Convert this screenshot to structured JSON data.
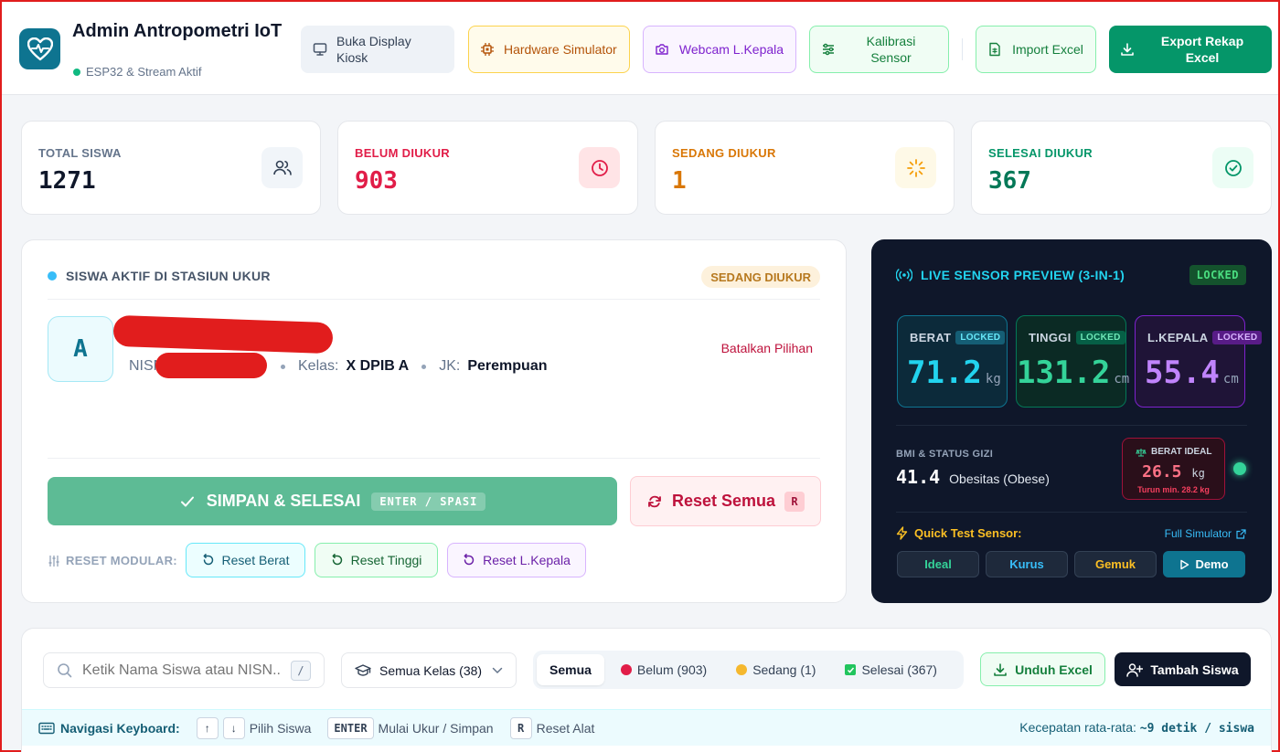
{
  "app": {
    "title": "Admin Antropometri IoT",
    "status": "ESP32 & Stream Aktif"
  },
  "toolbar": {
    "kiosk": "Buka Display Kiosk",
    "hardware_sim": "Hardware Simulator",
    "webcam": "Webcam L.Kepala",
    "calibrate": "Kalibrasi Sensor",
    "import": "Import Excel",
    "export": "Export Rekap Excel"
  },
  "stats": {
    "total": {
      "label": "TOTAL SISWA",
      "value": "1271"
    },
    "pending": {
      "label": "BELUM DIUKUR",
      "value": "903"
    },
    "measuring": {
      "label": "SEDANG DIUKUR",
      "value": "1"
    },
    "done": {
      "label": "SELESAI DIUKUR",
      "value": "367"
    }
  },
  "active": {
    "heading": "SISWA AKTIF DI STASIUN UKUR",
    "badge": "SEDANG DIUKUR",
    "avatar_letter": "A",
    "nisn_label": "NISN",
    "class_label": "Kelas:",
    "class_value": "X DPIB A",
    "gender_label": "JK:",
    "gender_value": "Perempuan",
    "cancel": "Batalkan Pilihan",
    "save_label": "SIMPAN & SELESAI",
    "save_shortcut": "ENTER / SPASI",
    "reset_all": "Reset Semua",
    "reset_all_key": "R",
    "modular_label": "RESET MODULAR:",
    "reset_weight": "Reset Berat",
    "reset_height": "Reset Tinggi",
    "reset_head": "Reset L.Kepala"
  },
  "sensor": {
    "heading": "LIVE SENSOR PREVIEW (3-IN-1)",
    "status": "LOCKED",
    "weight": {
      "label": "BERAT",
      "lock": "LOCKED",
      "value": "71.2",
      "unit": "kg"
    },
    "height": {
      "label": "TINGGI",
      "lock": "LOCKED",
      "value": "131.2",
      "unit": "cm"
    },
    "head": {
      "label": "L.KEPALA",
      "lock": "LOCKED",
      "value": "55.4",
      "unit": "cm"
    },
    "bmi_label": "BMI & STATUS GIZI",
    "bmi_value": "41.4",
    "bmi_status": "Obesitas (Obese)",
    "ideal_label": "BERAT IDEAL",
    "ideal_value": "26.5",
    "ideal_unit": "kg",
    "ideal_note": "Turun min. 28.2 kg",
    "quick_test": "Quick Test Sensor:",
    "full_sim": "Full Simulator",
    "btn_ideal": "Ideal",
    "btn_thin": "Kurus",
    "btn_fat": "Gemuk",
    "btn_demo": "Demo"
  },
  "list": {
    "search_placeholder": "Ketik Nama Siswa atau NISN...",
    "search_key": "/",
    "class_filter": "Semua Kelas (38)",
    "tabs": [
      "Semua",
      "Belum (903)",
      "Sedang (1)",
      "Selesai (367)"
    ],
    "download": "Unduh Excel",
    "add": "Tambah Siswa"
  },
  "keyboard": {
    "title": "Navigasi Keyboard:",
    "select_label": "Pilih Siswa",
    "enter_key": "ENTER",
    "enter_label": "Mulai Ukur / Simpan",
    "r_key": "R",
    "r_label": "Reset Alat",
    "speed_label": "Kecepatan rata-rata:",
    "speed_value": "~9 detik / siswa"
  },
  "colors": {
    "primary": "#0e7490",
    "success": "#5dbb95",
    "danger": "#be123c",
    "warning": "#d97706",
    "dark_panel": "#0f172a"
  }
}
